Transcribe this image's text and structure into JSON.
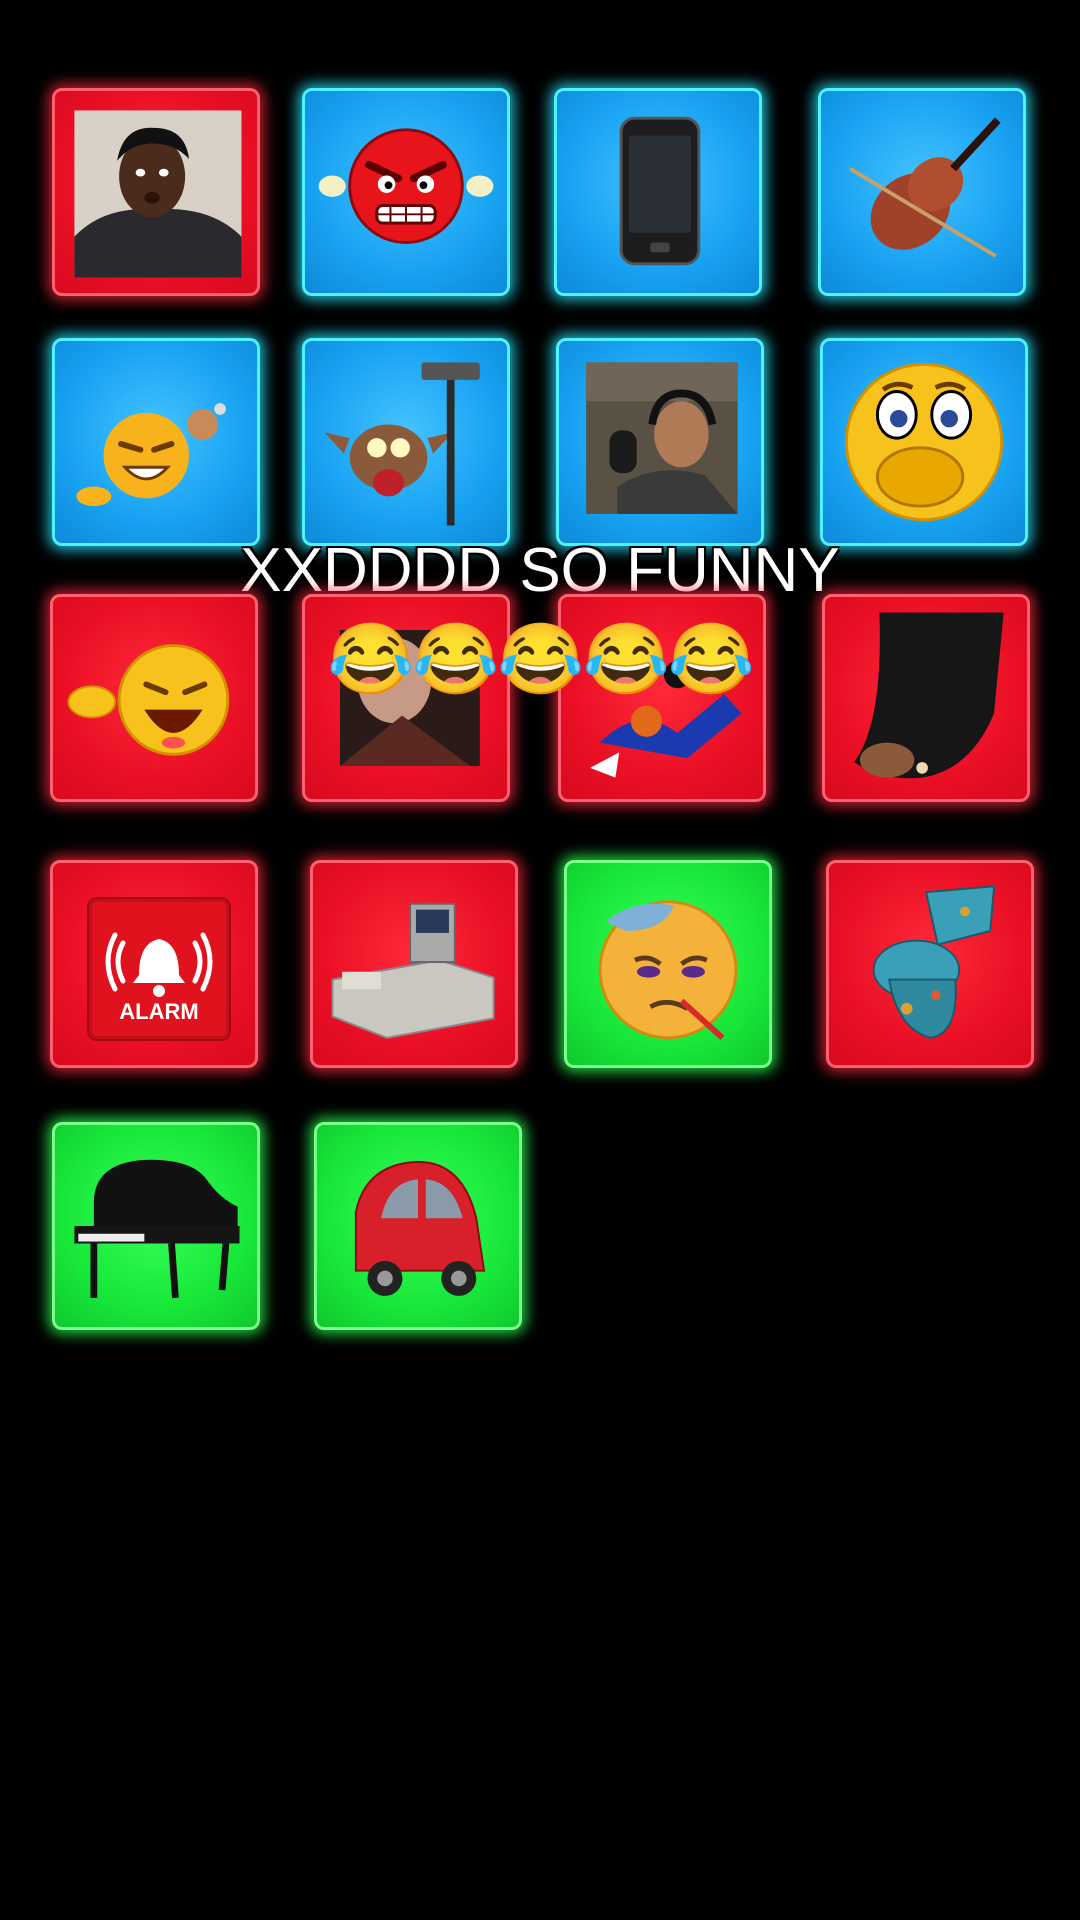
{
  "caption": "XXDDDD SO FUNNY",
  "caption_emojis": "😂😂😂😂😂",
  "colors": {
    "red": "#ea0f25",
    "blue": "#18a2f2",
    "green": "#18e83a",
    "background": "#000000"
  },
  "alarm_label": "ALARM",
  "pads": [
    {
      "name": "surprised-guy-pad",
      "color": "red"
    },
    {
      "name": "angry-face-pad",
      "color": "blue"
    },
    {
      "name": "phone-pad",
      "color": "blue"
    },
    {
      "name": "violin-pad",
      "color": "blue"
    },
    {
      "name": "laughing-pointing-pad",
      "color": "blue"
    },
    {
      "name": "cartoon-coyote-hammer-pad",
      "color": "blue"
    },
    {
      "name": "radio-studio-singer-pad",
      "color": "blue"
    },
    {
      "name": "shocked-face-pad",
      "color": "blue"
    },
    {
      "name": "laughing-emoji-pad",
      "color": "red"
    },
    {
      "name": "person-meme-pad",
      "color": "red"
    },
    {
      "name": "cartoon-falling-pad",
      "color": "red"
    },
    {
      "name": "dark-object-pad",
      "color": "red"
    },
    {
      "name": "alarm-pad",
      "color": "red"
    },
    {
      "name": "cash-register-pad",
      "color": "red"
    },
    {
      "name": "sick-face-pad",
      "color": "green"
    },
    {
      "name": "toilet-pad",
      "color": "red"
    },
    {
      "name": "piano-pad",
      "color": "green"
    },
    {
      "name": "small-car-pad",
      "color": "green"
    }
  ]
}
